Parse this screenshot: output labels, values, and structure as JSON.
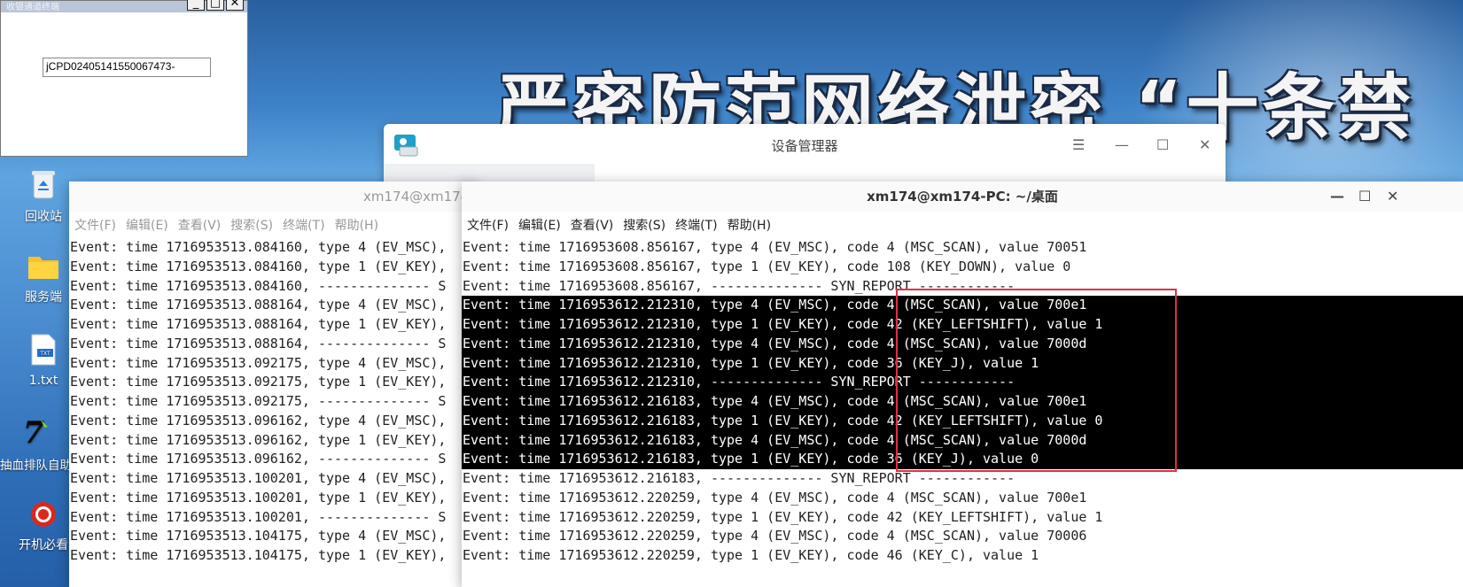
{
  "desktop": {
    "banner_text": "严密防范网络泄密 “十条禁",
    "icons": [
      {
        "label": "回收站"
      },
      {
        "label": "服务端"
      },
      {
        "label": "1.txt"
      },
      {
        "label": "抽血排队自助机系统"
      },
      {
        "label": "开机必看"
      }
    ]
  },
  "dialog": {
    "title": "收银通道终端",
    "field_value": "jCPD02405141550067473-",
    "buttons": [
      "_",
      "□",
      "✕"
    ]
  },
  "device_manager": {
    "title": "设备管理器",
    "controls": [
      "☰",
      "—",
      "☐",
      "✕"
    ]
  },
  "menu": [
    "文件(F)",
    "编辑(E)",
    "查看(V)",
    "搜索(S)",
    "终端(T)",
    "帮助(H)"
  ],
  "terminal_back": {
    "title": "xm174@xm174",
    "lines": [
      "Event: time 1716953513.084160, type 4 (EV_MSC),",
      "Event: time 1716953513.084160, type 1 (EV_KEY),",
      "Event: time 1716953513.084160, -------------- S",
      "Event: time 1716953513.088164, type 4 (EV_MSC),",
      "Event: time 1716953513.088164, type 1 (EV_KEY),",
      "Event: time 1716953513.088164, -------------- S",
      "Event: time 1716953513.092175, type 4 (EV_MSC),",
      "Event: time 1716953513.092175, type 1 (EV_KEY),",
      "Event: time 1716953513.092175, -------------- S",
      "Event: time 1716953513.096162, type 4 (EV_MSC),",
      "Event: time 1716953513.096162, type 1 (EV_KEY),",
      "Event: time 1716953513.096162, -------------- S",
      "Event: time 1716953513.100201, type 4 (EV_MSC),",
      "Event: time 1716953513.100201, type 1 (EV_KEY),",
      "Event: time 1716953513.100201, -------------- S",
      "Event: time 1716953513.104175, type 4 (EV_MSC),",
      "Event: time 1716953513.104175, type 1 (EV_KEY),"
    ]
  },
  "terminal_front": {
    "title": "xm174@xm174-PC: ~/桌面",
    "controls": [
      "—",
      "☐",
      "✕"
    ],
    "lines": [
      {
        "text": "Event: time 1716953608.856167, type 4 (EV_MSC), code 4 (MSC_SCAN), value 70051",
        "selected": false
      },
      {
        "text": "Event: time 1716953608.856167, type 1 (EV_KEY), code 108 (KEY_DOWN), value 0",
        "selected": false
      },
      {
        "text": "Event: time 1716953608.856167, -------------- SYN_REPORT ------------",
        "selected": false
      },
      {
        "text": "Event: time 1716953612.212310, type 4 (EV_MSC), code 4 (MSC_SCAN), value 700e1",
        "selected": true
      },
      {
        "text": "Event: time 1716953612.212310, type 1 (EV_KEY), code 42 (KEY_LEFTSHIFT), value 1",
        "selected": true
      },
      {
        "text": "Event: time 1716953612.212310, type 4 (EV_MSC), code 4 (MSC_SCAN), value 7000d",
        "selected": true
      },
      {
        "text": "Event: time 1716953612.212310, type 1 (EV_KEY), code 36 (KEY_J), value 1",
        "selected": true
      },
      {
        "text": "Event: time 1716953612.212310, -------------- SYN_REPORT ------------",
        "selected": true
      },
      {
        "text": "Event: time 1716953612.216183, type 4 (EV_MSC), code 4 (MSC_SCAN), value 700e1",
        "selected": true
      },
      {
        "text": "Event: time 1716953612.216183, type 1 (EV_KEY), code 42 (KEY_LEFTSHIFT), value 0",
        "selected": true
      },
      {
        "text": "Event: time 1716953612.216183, type 4 (EV_MSC), code 4 (MSC_SCAN), value 7000d",
        "selected": true
      },
      {
        "text": "Event: time 1716953612.216183, type 1 (EV_KEY), code 36 (KEY_J), value 0",
        "selected": true
      },
      {
        "text": "Event: time 1716953612.216183, -------------- SYN_REPORT ------------",
        "selected": false
      },
      {
        "text": "Event: time 1716953612.220259, type 4 (EV_MSC), code 4 (MSC_SCAN), value 700e1",
        "selected": false
      },
      {
        "text": "Event: time 1716953612.220259, type 1 (EV_KEY), code 42 (KEY_LEFTSHIFT), value 1",
        "selected": false
      },
      {
        "text": "Event: time 1716953612.220259, type 4 (EV_MSC), code 4 (MSC_SCAN), value 70006",
        "selected": false
      },
      {
        "text": "Event: time 1716953612.220259, type 1 (EV_KEY), code 46 (KEY_C), value 1",
        "selected": false
      }
    ]
  },
  "colors": {
    "highlight_box": "#e03040",
    "selection_bg": "#000000"
  }
}
